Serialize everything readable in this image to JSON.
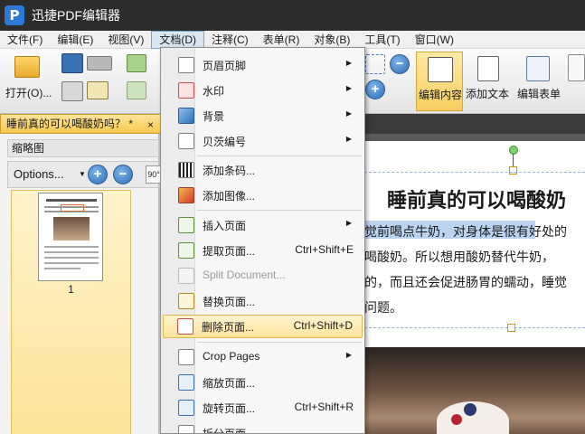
{
  "window": {
    "title": "迅捷PDF编辑器",
    "logo_letter": "P"
  },
  "menubar": {
    "items": [
      {
        "label": "文件(F)"
      },
      {
        "label": "编辑(E)"
      },
      {
        "label": "视图(V)"
      },
      {
        "label": "文档(D)"
      },
      {
        "label": "注释(C)"
      },
      {
        "label": "表单(R)"
      },
      {
        "label": "对象(B)"
      },
      {
        "label": "工具(T)"
      },
      {
        "label": "窗口(W)"
      }
    ],
    "active": "文档(D)"
  },
  "ribbon": {
    "open_label": "打开(O)...",
    "edit_content_label": "编辑内容",
    "add_text_label": "添加文本",
    "edit_form_label": "编辑表单"
  },
  "document_tab": {
    "title": "睡前真的可以喝酸奶吗？ *",
    "close": "×"
  },
  "thumbnail_panel": {
    "header": "缩略图",
    "options_label": "Options...",
    "rotate_label": "90°",
    "page_number": "1"
  },
  "doc_menu": {
    "items": [
      {
        "label": "页眉页脚",
        "submenu": true,
        "icon": "header-footer-icon"
      },
      {
        "label": "水印",
        "submenu": true,
        "icon": "watermark-icon"
      },
      {
        "label": "背景",
        "submenu": true,
        "icon": "background-icon"
      },
      {
        "label": "贝茨编号",
        "submenu": true,
        "icon": "bates-number-icon"
      },
      {
        "label": "添加条码...",
        "icon": "barcode-icon"
      },
      {
        "label": "添加图像...",
        "icon": "add-image-icon"
      },
      {
        "label": "插入页面",
        "submenu": true,
        "icon": "insert-page-icon"
      },
      {
        "label": "提取页面...",
        "shortcut": "Ctrl+Shift+E",
        "icon": "extract-page-icon"
      },
      {
        "label": "Split Document...",
        "disabled": true,
        "icon": "split-document-icon"
      },
      {
        "label": "替换页面...",
        "icon": "replace-page-icon"
      },
      {
        "label": "删除页面...",
        "shortcut": "Ctrl+Shift+D",
        "highlighted": true,
        "icon": "delete-page-icon"
      },
      {
        "label": "Crop Pages",
        "submenu": true,
        "icon": "crop-pages-icon"
      },
      {
        "label": "缩放页面...",
        "icon": "resize-page-icon"
      },
      {
        "label": "旋转页面...",
        "shortcut": "Ctrl+Shift+R",
        "icon": "rotate-page-icon"
      },
      {
        "label": "拆分页面...",
        "icon": "split-page-icon"
      }
    ]
  },
  "document": {
    "title": "睡前真的可以喝酸奶",
    "lines": [
      "觉前喝点牛奶，对身体是很有好处的",
      "喝酸奶。所以想用酸奶替代牛奶，",
      "的，而且还会促进肠胃的蠕动，睡觉",
      "问题。"
    ],
    "selected_text": "觉前喝点牛奶，对身体是很"
  },
  "colors": {
    "titlebar": "#2c2c2c",
    "highlight": "#fde49c",
    "text_selection": "#bcd3f0",
    "accent_blue": "#2d6db5"
  }
}
